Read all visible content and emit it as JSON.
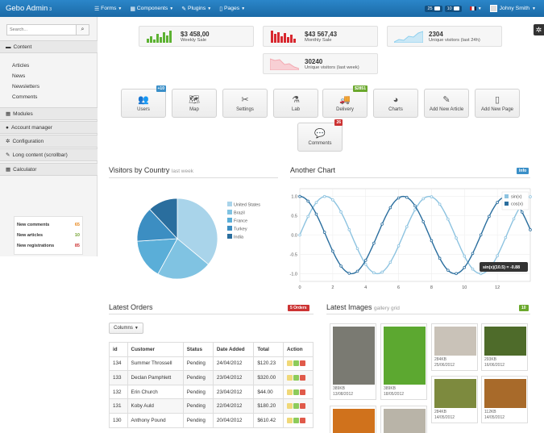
{
  "navbar": {
    "brand": "Gebo Admin",
    "brand_version": "3",
    "menus": [
      "Forms",
      "Components",
      "Plugins",
      "Pages"
    ],
    "mail_count": "25",
    "task_count": "10",
    "user_name": "Johny Smith"
  },
  "sidebar": {
    "search_placeholder": "Search...",
    "content_label": "Content",
    "content_items": [
      "Articles",
      "News",
      "Newsletters",
      "Comments"
    ],
    "sections": [
      "Modules",
      "Account manager",
      "Configuration",
      "Long content (scrollbar)",
      "Calculator"
    ],
    "stats": [
      {
        "label": "New comments",
        "value": "65"
      },
      {
        "label": "New articles",
        "value": "10"
      },
      {
        "label": "New registrations",
        "value": "85"
      }
    ]
  },
  "stat_boxes": [
    {
      "value": "$3 458,00",
      "label": "Weekly Sale",
      "color": "#5cb232"
    },
    {
      "value": "$43 567,43",
      "label": "Monthly Sale",
      "color": "#d8282f"
    },
    {
      "value": "2304",
      "label": "Unique visitors (last 24h)",
      "color": "#8dcfee"
    },
    {
      "value": "30240",
      "label": "Unique visitors (last week)",
      "color": "#f3a8b0"
    }
  ],
  "shortcuts": [
    {
      "label": "Users",
      "badge": "+10"
    },
    {
      "label": "Map",
      "badge": ""
    },
    {
      "label": "Settings",
      "badge": ""
    },
    {
      "label": "Lab",
      "badge": ""
    },
    {
      "label": "Delivery",
      "badge": "$2851"
    },
    {
      "label": "Charts",
      "badge": ""
    },
    {
      "label": "Add New Article",
      "badge": ""
    },
    {
      "label": "Add New Page",
      "badge": ""
    },
    {
      "label": "Comments",
      "badge": "26"
    }
  ],
  "visitors": {
    "title": "Visitors by Country",
    "subtitle": "last week"
  },
  "another_chart": {
    "title": "Another Chart",
    "badge": "Info"
  },
  "orders": {
    "title": "Latest Orders",
    "badge": "5 Orders",
    "columns_button": "Columns",
    "headers": [
      "id",
      "Customer",
      "Status",
      "Date Added",
      "Total",
      "Action"
    ],
    "rows": [
      [
        "134",
        "Summer Throssell",
        "Pending",
        "24/04/2012",
        "$120.23"
      ],
      [
        "133",
        "Declan Pamphlett",
        "Pending",
        "23/04/2012",
        "$320.00"
      ],
      [
        "132",
        "Erin Church",
        "Pending",
        "23/04/2012",
        "$44.00"
      ],
      [
        "131",
        "Koby Auld",
        "Pending",
        "22/04/2012",
        "$180.20"
      ],
      [
        "130",
        "Anthony Pound",
        "Pending",
        "20/04/2012",
        "$610.42"
      ]
    ]
  },
  "gallery": {
    "title": "Latest Images",
    "subtitle": "gallery grid",
    "badge": "10",
    "images": [
      {
        "size": "389KB",
        "date": "13/08/2012",
        "color": "#7a7a72"
      },
      {
        "size": "389KB",
        "date": "18/05/2012",
        "color": "#5ca830"
      },
      {
        "size": "284KB",
        "date": "25/06/2012",
        "color": "#c9c2b8"
      },
      {
        "size": "293KB",
        "date": "16/06/2012",
        "color": "#4e6b2a"
      },
      {
        "size": "284KB",
        "date": "14/05/2012",
        "color": "#7d8a3e"
      },
      {
        "size": "112KB",
        "date": "14/05/2012",
        "color": "#a86a2a"
      }
    ]
  },
  "chart_data": [
    {
      "type": "pie",
      "title": "Visitors by Country",
      "categories": [
        "United States",
        "Brazil",
        "France",
        "Turkey",
        "India"
      ],
      "values": [
        36,
        22,
        16,
        14,
        12
      ],
      "colors": [
        "#a9d4ea",
        "#80c3e2",
        "#5aaed8",
        "#3c8ec2",
        "#2a6e9e"
      ],
      "legend": "right"
    },
    {
      "type": "line",
      "title": "Another Chart",
      "xlim": [
        0,
        14
      ],
      "ylim": [
        -1.2,
        1.2
      ],
      "xticks": [
        0,
        2,
        4,
        6,
        8,
        10,
        12
      ],
      "yticks": [
        -1.0,
        -0.5,
        0.0,
        0.5,
        1.0
      ],
      "series": [
        {
          "name": "sin(x)",
          "color": "#8dc3e0"
        },
        {
          "name": "cos(x)",
          "color": "#2a6e9e"
        }
      ],
      "tooltip": "sin(x)(10.5) = -0.88",
      "grid": true,
      "legend": "top-right"
    }
  ]
}
